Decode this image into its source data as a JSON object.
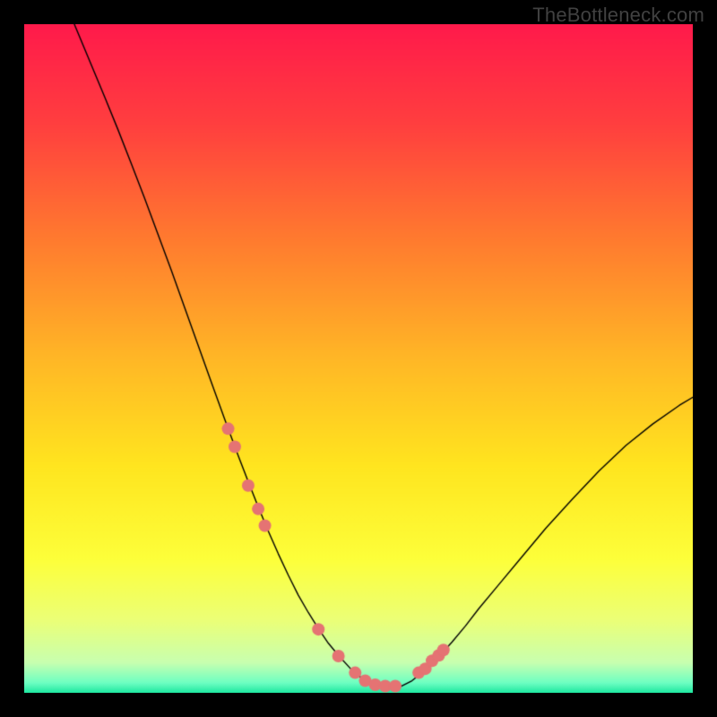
{
  "watermark": "TheBottleneck.com",
  "chart_data": {
    "type": "line",
    "title": "",
    "xlabel": "",
    "ylabel": "",
    "xlim": [
      0,
      100
    ],
    "ylim": [
      0,
      100
    ],
    "grid": false,
    "legend": false,
    "background": {
      "type": "vertical-gradient",
      "stops": [
        {
          "pos": 0.0,
          "color": "#ff1a4b"
        },
        {
          "pos": 0.15,
          "color": "#ff3f3f"
        },
        {
          "pos": 0.32,
          "color": "#ff7a2f"
        },
        {
          "pos": 0.5,
          "color": "#ffb726"
        },
        {
          "pos": 0.66,
          "color": "#ffe51f"
        },
        {
          "pos": 0.8,
          "color": "#fdff3a"
        },
        {
          "pos": 0.89,
          "color": "#ecff76"
        },
        {
          "pos": 0.955,
          "color": "#c8ffb0"
        },
        {
          "pos": 0.985,
          "color": "#6effc2"
        },
        {
          "pos": 1.0,
          "color": "#1ee8a0"
        }
      ]
    },
    "series": [
      {
        "name": "curve",
        "stroke": "#000000",
        "stroke_width": 1.4,
        "x": [
          7.5,
          10,
          12,
          14,
          16,
          18,
          20,
          22,
          24,
          26,
          28,
          30,
          32,
          33.5,
          35,
          36.5,
          38,
          39.5,
          41,
          42.5,
          44,
          45.5,
          47,
          49,
          51,
          53.5,
          56,
          58,
          60,
          62,
          64,
          66,
          68,
          71,
          74,
          78,
          82,
          86,
          90,
          94,
          98,
          100
        ],
        "y": [
          100,
          94,
          89.2,
          84.3,
          79.2,
          74,
          68.6,
          63.2,
          57.6,
          52,
          46.4,
          40.9,
          35.5,
          31.6,
          27.8,
          24.2,
          20.8,
          17.6,
          14.6,
          12,
          9.6,
          7.4,
          5.6,
          3.4,
          1.8,
          0.8,
          0.8,
          1.8,
          3.4,
          5.4,
          7.6,
          10,
          12.6,
          16.2,
          19.8,
          24.6,
          29,
          33.2,
          37,
          40.2,
          43,
          44.2
        ]
      }
    ],
    "markers": {
      "name": "points",
      "color": "#e57373",
      "radius": 7,
      "x": [
        30.5,
        31.5,
        33.5,
        35,
        36,
        44,
        47,
        49.5,
        51,
        52.5,
        54,
        55.5,
        59,
        60,
        61,
        62,
        62.7
      ],
      "y": [
        39.5,
        36.8,
        31,
        27.5,
        25,
        9.5,
        5.5,
        3,
        1.8,
        1.2,
        1,
        1,
        3,
        3.6,
        4.8,
        5.6,
        6.4
      ]
    }
  }
}
